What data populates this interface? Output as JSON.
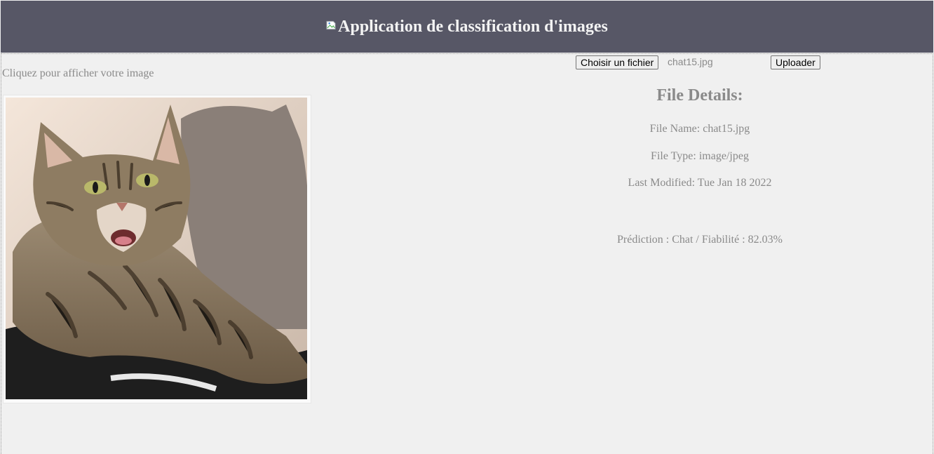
{
  "header": {
    "title": "Application de classification d'images",
    "broken_image_icon": "broken-image-icon"
  },
  "left": {
    "hint": "Cliquez pour afficher votre image"
  },
  "upload": {
    "choose_label": "Choisir un fichier",
    "chosen_file": "chat15.jpg",
    "upload_label": "Uploader"
  },
  "details": {
    "title": "File Details:",
    "file_name": "File Name: chat15.jpg",
    "file_type": "File Type: image/jpeg",
    "last_modified": "Last Modified: Tue Jan 18 2022",
    "prediction": "Prédiction : Chat / Fiabilité : 82.03%"
  },
  "colors": {
    "header_bg": "#575766",
    "page_bg": "#f0f0f0",
    "muted_text": "#8a8a8a"
  }
}
